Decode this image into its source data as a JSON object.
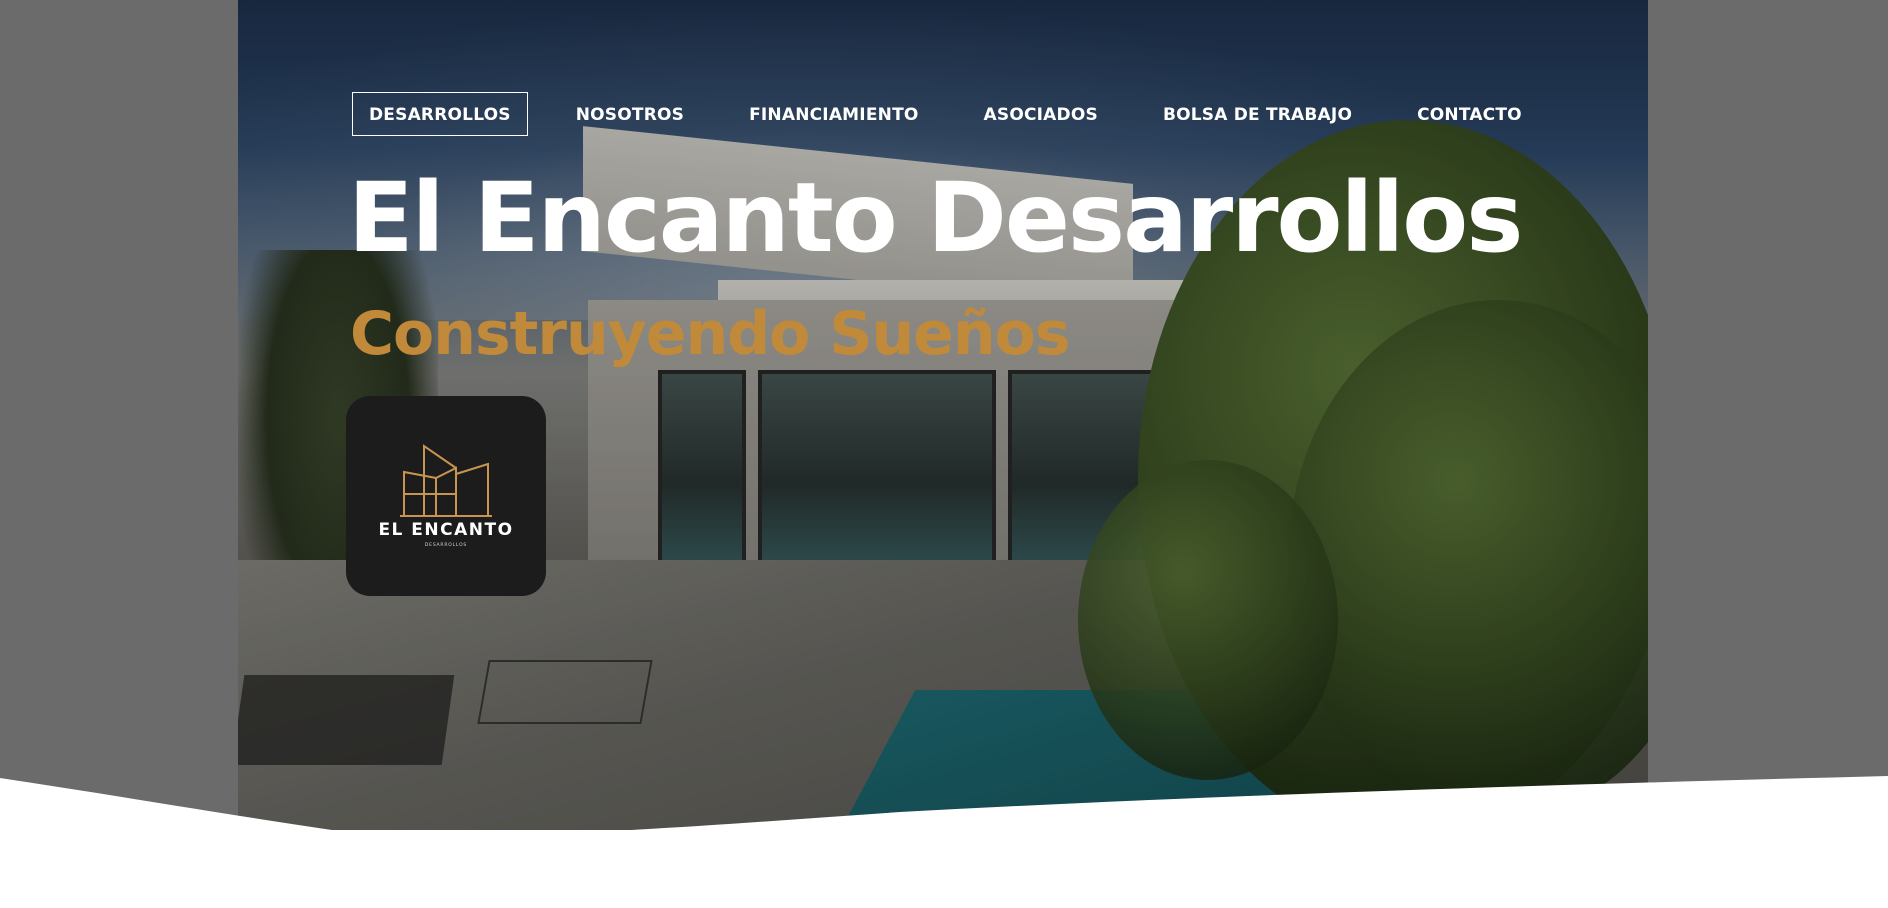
{
  "nav": {
    "items": [
      {
        "label": "DESARROLLOS",
        "active": true
      },
      {
        "label": "NOSOTROS",
        "active": false
      },
      {
        "label": "FINANCIAMIENTO",
        "active": false
      },
      {
        "label": "ASOCIADOS",
        "active": false
      },
      {
        "label": "BOLSA DE TRABAJO",
        "active": false
      },
      {
        "label": "CONTACTO",
        "active": false
      }
    ]
  },
  "hero": {
    "title": "El Encanto Desarrollos",
    "subtitle": "Construyendo Sueños",
    "background_image": "modern-house-with-pool-photo"
  },
  "logo": {
    "name": "EL ENCANTO",
    "sub": "DESARROLLOS",
    "icon": "building-outline-icon",
    "accent_color": "#c89550"
  },
  "colors": {
    "accent": "#c08a3a",
    "text_light": "#ffffff",
    "side_band": "#6b6b6b",
    "logo_bg": "#1c1c1c"
  }
}
